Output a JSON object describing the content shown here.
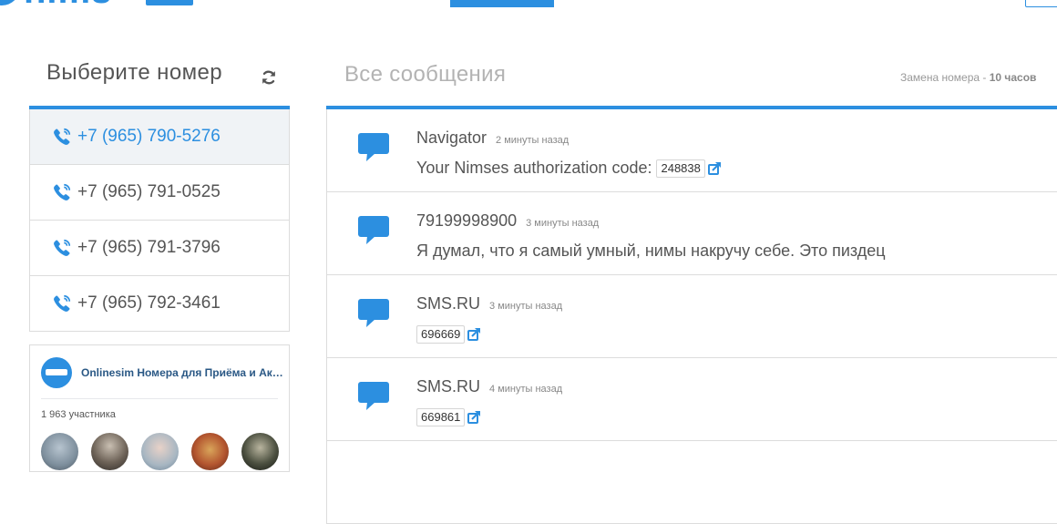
{
  "header": {
    "logo_text": "nims"
  },
  "numbers_panel": {
    "title": "Выберите номер",
    "numbers": [
      "+7 (965) 790-5276",
      "+7 (965) 791-0525",
      "+7 (965) 791-3796",
      "+7 (965) 792-3461"
    ],
    "active_index": 0
  },
  "vk_widget": {
    "group_name": "Onlinesim Номера для Приёма и Активации",
    "members": "1 963 участника"
  },
  "messages_panel": {
    "title": "Все сообщения",
    "note_label": "Замена номера - ",
    "note_value": "10 часов",
    "messages": [
      {
        "sender": "Navigator",
        "time": "2 минуты назад",
        "text_prefix": "Your Nimses authorization code: ",
        "code": "248838"
      },
      {
        "sender": "79199998900",
        "time": "3 минуты назад",
        "text_prefix": "Я думал, что я самый умный, нимы накручу себе. Это пиздец",
        "code": ""
      },
      {
        "sender": "SMS.RU",
        "time": "3 минуты назад",
        "text_prefix": "",
        "code": "696669"
      },
      {
        "sender": "SMS.RU",
        "time": "4 минуты назад",
        "text_prefix": "",
        "code": "669861"
      }
    ]
  },
  "colors": {
    "accent": "#2c8fe0",
    "active_row_bg": "#f0f3f6",
    "text": "#555555",
    "muted": "#b3b3b3"
  }
}
